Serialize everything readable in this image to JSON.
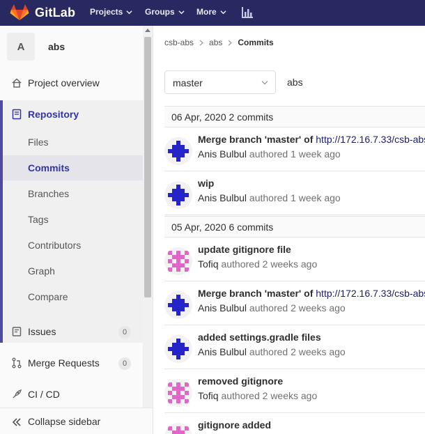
{
  "navbar": {
    "brand": "GitLab",
    "items": [
      {
        "label": "Projects"
      },
      {
        "label": "Groups"
      },
      {
        "label": "More"
      }
    ],
    "chart_icon": "activity-chart-icon"
  },
  "sidebar": {
    "project_avatar_letter": "A",
    "project_name": "abs",
    "project_overview": "Project overview",
    "repository": {
      "label": "Repository",
      "items": [
        "Files",
        "Commits",
        "Branches",
        "Tags",
        "Contributors",
        "Graph",
        "Compare"
      ],
      "active": "Commits"
    },
    "issues": {
      "label": "Issues",
      "count": "0"
    },
    "merge_requests": {
      "label": "Merge Requests",
      "count": "0"
    },
    "ci_cd": "CI / CD",
    "collapse": "Collapse sidebar"
  },
  "breadcrumb": [
    "csb-abs",
    "abs",
    "Commits"
  ],
  "branch": "master",
  "path": "abs",
  "days": [
    {
      "date": "06 Apr, 2020 2 commits",
      "commits": [
        {
          "title": "Merge branch 'master' of ",
          "link": "http://172.16.7.33/csb-abs",
          "author": "Anis Bulbul",
          "verb": " authored ",
          "time": "1 week ago",
          "avatar": "purple"
        },
        {
          "title": "wip",
          "link": "",
          "author": "Anis Bulbul",
          "verb": " authored ",
          "time": "1 week ago",
          "avatar": "purple"
        }
      ]
    },
    {
      "date": "05 Apr, 2020 6 commits",
      "commits": [
        {
          "title": "update gitignore file",
          "link": "",
          "author": "Tofiq",
          "verb": " authored ",
          "time": "2 weeks ago",
          "avatar": "pink"
        },
        {
          "title": "Merge branch 'master' of ",
          "link": "http://172.16.7.33/csb-abs",
          "author": "Anis Bulbul",
          "verb": " authored ",
          "time": "2 weeks ago",
          "avatar": "purple"
        },
        {
          "title": "added settings.gradle files",
          "link": "",
          "author": "Anis Bulbul",
          "verb": " authored ",
          "time": "2 weeks ago",
          "avatar": "purple"
        },
        {
          "title": "removed gitignore",
          "link": "",
          "author": "Tofiq",
          "verb": " authored ",
          "time": "2 weeks ago",
          "avatar": "pink"
        },
        {
          "title": "gitignore added",
          "link": "",
          "author": "",
          "verb": "",
          "time": "",
          "avatar": "pink"
        }
      ]
    }
  ],
  "colors": {
    "navbar": "#292961",
    "accent": "#4b4ba3",
    "avatar_purple": "#2424c8",
    "avatar_pink": "#e066c8"
  }
}
